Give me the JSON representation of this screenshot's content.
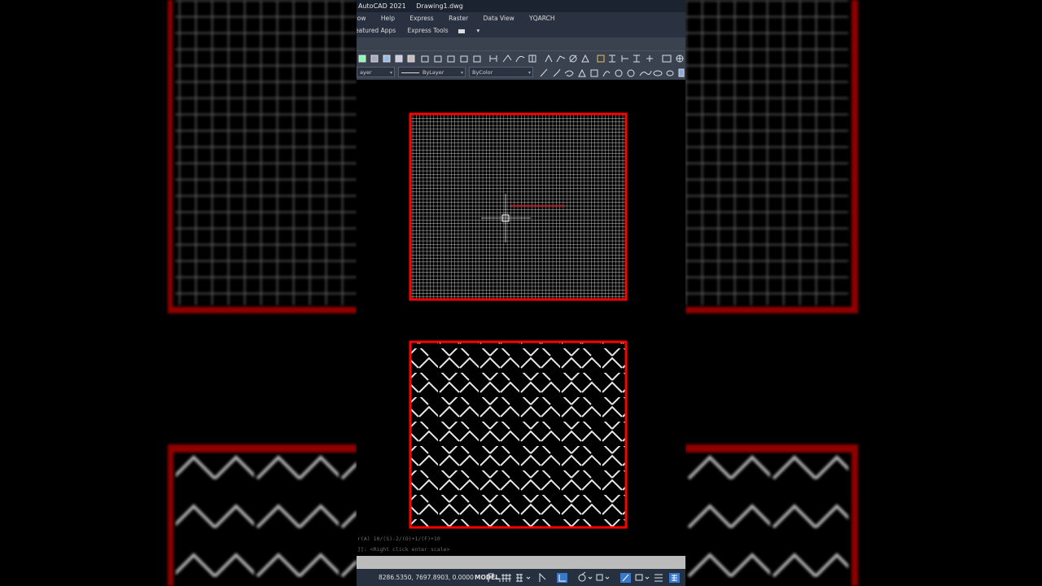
{
  "app": {
    "title": "AutoCAD 2021",
    "document": "Drawing1.dwg"
  },
  "menu": {
    "items": [
      "dow",
      "Help",
      "Express",
      "Raster",
      "Data View",
      "YQARCH"
    ]
  },
  "tabs": {
    "items": [
      "eatured Apps",
      "Express Tools"
    ]
  },
  "properties": {
    "layer": "ayer",
    "linetype": "ByLayer",
    "color": "ByColor"
  },
  "drawing": {
    "colors": {
      "boundary": "#ff0000",
      "hatch": "#d8d8d8",
      "background": "#000000",
      "cursor_label": "#aa2222"
    }
  },
  "command_line": {
    "history": [
      "r(A) 10/(S)-2/(O)+1/(F)+10",
      "]]: <Right click enter scale>"
    ]
  },
  "status": {
    "coordinates": "8286.5350, 7697.8903, 0.0000",
    "space": "MODEL"
  }
}
